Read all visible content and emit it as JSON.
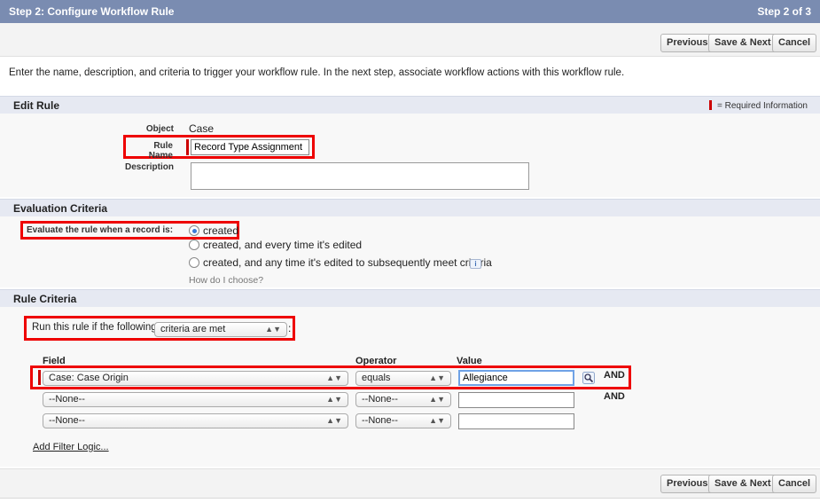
{
  "header": {
    "title": "Step 2: Configure Workflow Rule",
    "step": "Step 2 of 3"
  },
  "buttons": {
    "previous": "Previous",
    "save_next": "Save & Next",
    "cancel": "Cancel"
  },
  "intro": "Enter the name, description, and criteria to trigger your workflow rule. In the next step, associate workflow actions with this workflow rule.",
  "edit_rule": {
    "title": "Edit Rule",
    "required_legend": "= Required Information",
    "object_label": "Object",
    "object_value": "Case",
    "rule_name_label": "Rule Name",
    "rule_name_value": "Record Type Assignment F",
    "description_label": "Description",
    "description_value": ""
  },
  "evaluation": {
    "title": "Evaluation Criteria",
    "label": "Evaluate the rule when a record is:",
    "options": [
      "created",
      "created, and every time it's edited",
      "created, and any time it's edited to subsequently meet criteria"
    ],
    "selected_index": 0,
    "hint": "How do I choose?"
  },
  "rule_criteria": {
    "title": "Rule Criteria",
    "run_label": "Run this rule if the following",
    "run_select": "criteria are met",
    "run_suffix": ":",
    "col_field": "Field",
    "col_operator": "Operator",
    "col_value": "Value",
    "rows": [
      {
        "field": "Case: Case Origin",
        "operator": "equals",
        "value": "Allegiance",
        "conj": "AND"
      },
      {
        "field": "--None--",
        "operator": "--None--",
        "value": "",
        "conj": "AND"
      },
      {
        "field": "--None--",
        "operator": "--None--",
        "value": "",
        "conj": ""
      }
    ],
    "add_filter_logic": "Add Filter Logic..."
  },
  "icons": {
    "lookup": "magnifier-lookup-icon",
    "info": "info-icon"
  },
  "colors": {
    "header": "#7a8cb1",
    "required": "#cc0000",
    "highlight": "#ee0000",
    "section": "#e6e9f2"
  }
}
